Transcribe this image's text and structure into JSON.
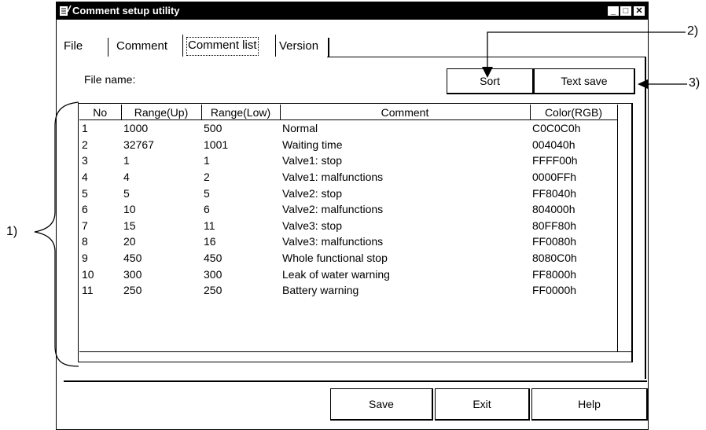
{
  "window": {
    "title": "Comment setup utility",
    "minimize_symbol": "_",
    "maximize_symbol": "□",
    "close_symbol": "✕"
  },
  "tabs": [
    {
      "label": "File"
    },
    {
      "label": "Comment"
    },
    {
      "label": "Comment list",
      "selected": true
    },
    {
      "label": "Version"
    }
  ],
  "file_name_label": "File name:",
  "buttons": {
    "sort": "Sort",
    "text_save": "Text save",
    "save": "Save",
    "exit": "Exit",
    "help": "Help"
  },
  "table": {
    "columns": [
      "No",
      "Range(Up)",
      "Range(Low)",
      "Comment",
      "Color(RGB)"
    ],
    "rows": [
      [
        "1",
        "1000",
        "500",
        "Normal",
        "C0C0C0h"
      ],
      [
        "2",
        "32767",
        "1001",
        "Waiting time",
        "004040h"
      ],
      [
        "3",
        "1",
        "1",
        "Valve1: stop",
        "FFFF00h"
      ],
      [
        "4",
        "4",
        "2",
        "Valve1: malfunctions",
        "0000FFh"
      ],
      [
        "5",
        "5",
        "5",
        "Valve2: stop",
        "FF8040h"
      ],
      [
        "6",
        "10",
        "6",
        "Valve2: malfunctions",
        "804000h"
      ],
      [
        "7",
        "15",
        "11",
        "Valve3: stop",
        "80FF80h"
      ],
      [
        "8",
        "20",
        "16",
        "Valve3: malfunctions",
        "FF0080h"
      ],
      [
        "9",
        "450",
        "450",
        "Whole functional stop",
        "8080C0h"
      ],
      [
        "10",
        "300",
        "300",
        "Leak of water warning",
        "FF8000h"
      ],
      [
        "11",
        "250",
        "250",
        "Battery warning",
        "FF0000h"
      ]
    ]
  },
  "callouts": {
    "c1": "1)",
    "c2": "2)",
    "c3": "3)"
  }
}
